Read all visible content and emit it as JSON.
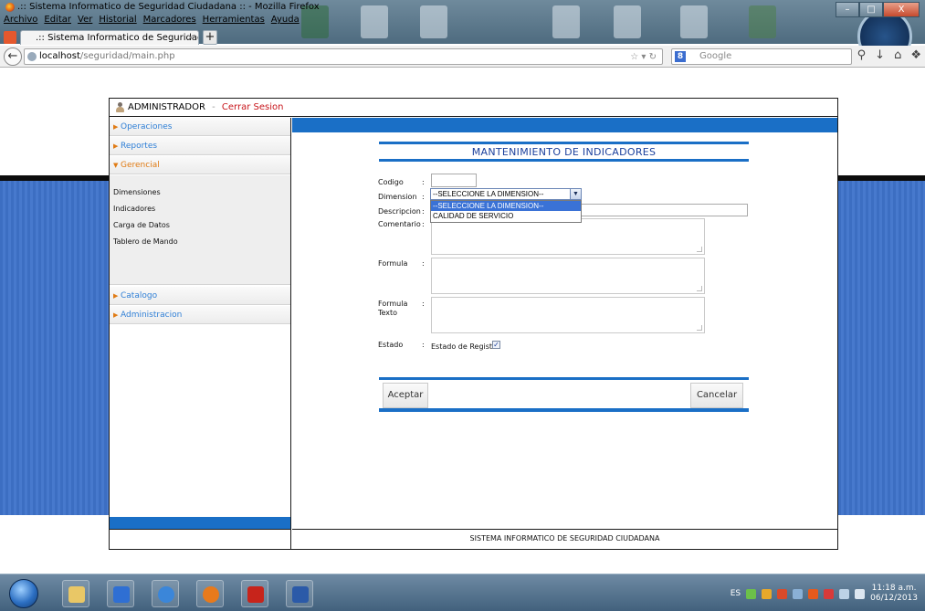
{
  "browser": {
    "window_title": ".:: Sistema Informatico de Seguridad Ciudadana :: - Mozilla Firefox",
    "menu": [
      "Archivo",
      "Editar",
      "Ver",
      "Historial",
      "Marcadores",
      "Herramientas",
      "Ayuda"
    ],
    "tab_title": ".:: Sistema Informatico de Seguridad ...",
    "tab_close": "×",
    "new_tab": "+",
    "url_host": "localhost",
    "url_path": "/seguridad/main.php",
    "search_placeholder": "Google",
    "controls": {
      "minimize": "–",
      "maximize": "□",
      "close": "X"
    }
  },
  "app": {
    "user": "ADMINISTRADOR",
    "separator": "-",
    "logout": "Cerrar Sesion",
    "footer": "SISTEMA INFORMATICO DE SEGURIDAD CIUDADANA"
  },
  "sidebar": {
    "sections": [
      {
        "label": "Operaciones",
        "open": false
      },
      {
        "label": "Reportes",
        "open": false
      },
      {
        "label": "Gerencial",
        "open": true
      },
      {
        "label": "Catalogo",
        "open": false
      },
      {
        "label": "Administracion",
        "open": false
      }
    ],
    "gerencial_items": [
      "Dimensiones",
      "Indicadores",
      "Carga de Datos",
      "Tablero de Mando"
    ]
  },
  "form": {
    "title": "MANTENIMIENTO DE INDICADORES",
    "colon": ":",
    "labels": {
      "codigo": "Codigo",
      "dimension": "Dimension",
      "descripcion": "Descripcion",
      "comentario": "Comentario",
      "formula": "Formula",
      "formula_texto_1": "Formula",
      "formula_texto_2": "Texto",
      "estado": "Estado",
      "estado_registro": "Estado de Registro"
    },
    "dimension_selected": "--SELECCIONE LA DIMENSION--",
    "dimension_options": [
      "--SELECCIONE LA DIMENSION--",
      "CALIDAD DE SERVICIO"
    ],
    "dimension_highlighted": 0,
    "estado_checked": true,
    "accept": "Aceptar",
    "cancel": "Cancelar"
  },
  "taskbar": {
    "language": "ES",
    "time": "11:18 a.m.",
    "date": "06/12/2013"
  }
}
